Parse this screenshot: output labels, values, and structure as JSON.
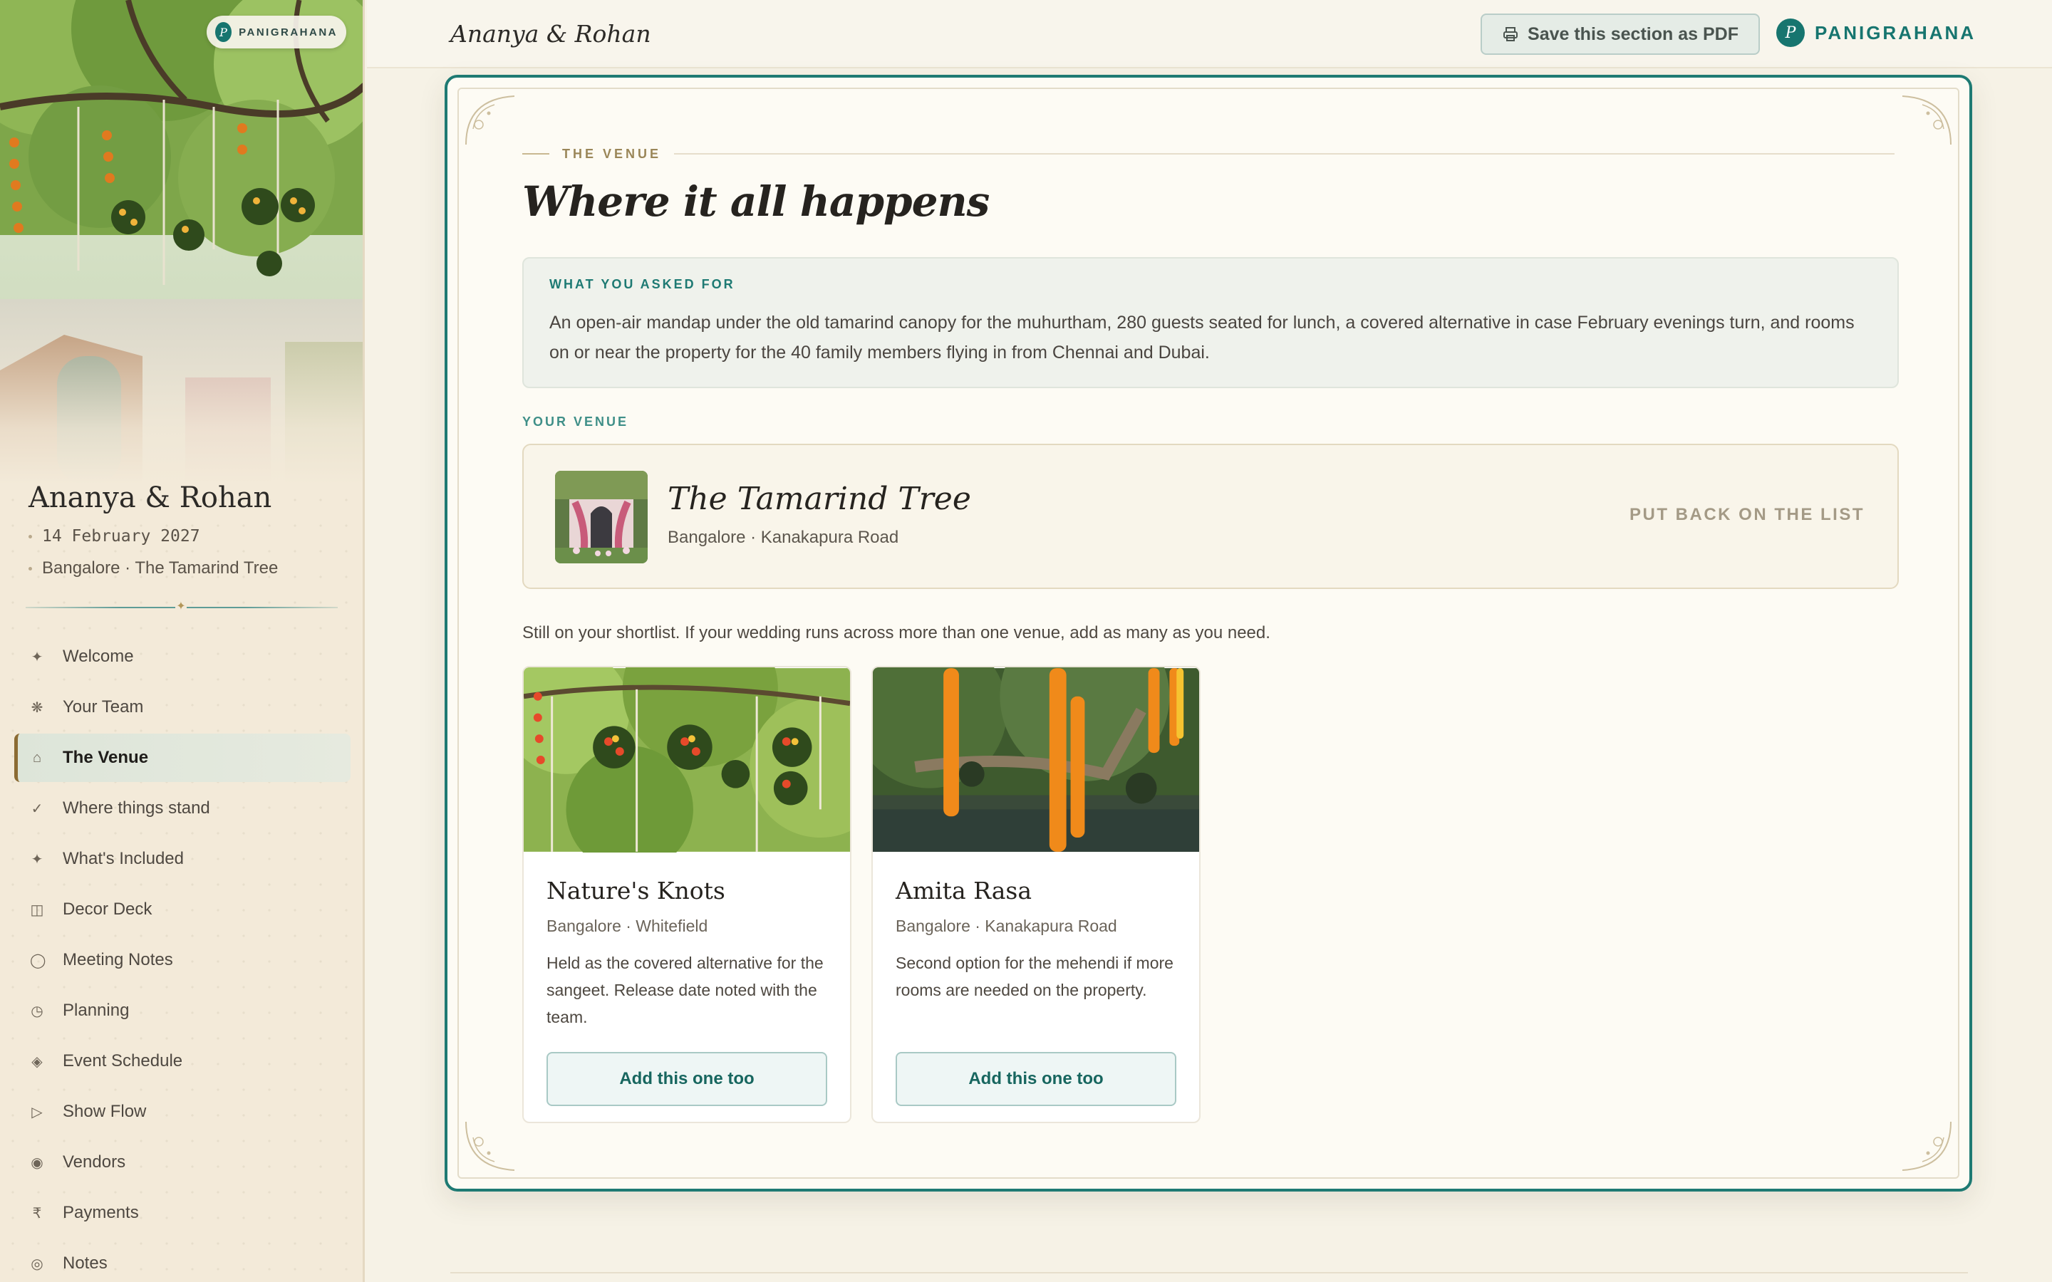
{
  "sidebar": {
    "brand_pill": "PANIGRAHANA",
    "brand_initial": "P",
    "couple_name": "Ananya & Rohan",
    "date": "14 February 2027",
    "location": "Bangalore · The Tamarind Tree",
    "divider_glyph": "✦",
    "items": [
      {
        "label": "Welcome",
        "icon": "✦",
        "icon_name": "sparkle-icon",
        "active": false
      },
      {
        "label": "Your Team",
        "icon": "❋",
        "icon_name": "flower-icon",
        "active": false
      },
      {
        "label": "The Venue",
        "icon": "⌂",
        "icon_name": "home-icon",
        "active": true
      },
      {
        "label": "Where things stand",
        "icon": "✓",
        "icon_name": "check-icon",
        "active": false
      },
      {
        "label": "What's Included",
        "icon": "✦",
        "icon_name": "sparkle-icon",
        "active": false
      },
      {
        "label": "Decor Deck",
        "icon": "◫",
        "icon_name": "deck-icon",
        "active": false
      },
      {
        "label": "Meeting Notes",
        "icon": "◯",
        "icon_name": "circle-icon",
        "active": false
      },
      {
        "label": "Planning",
        "icon": "◷",
        "icon_name": "clock-icon",
        "active": false
      },
      {
        "label": "Event Schedule",
        "icon": "◈",
        "icon_name": "diamond-icon",
        "active": false
      },
      {
        "label": "Show Flow",
        "icon": "▷",
        "icon_name": "play-icon",
        "active": false
      },
      {
        "label": "Vendors",
        "icon": "◉",
        "icon_name": "dot-circle-icon",
        "active": false
      },
      {
        "label": "Payments",
        "icon": "₹",
        "icon_name": "rupee-icon",
        "active": false
      },
      {
        "label": "Notes",
        "icon": "◎",
        "icon_name": "target-icon",
        "active": false
      }
    ]
  },
  "topbar": {
    "title": "Ananya & Rohan",
    "pdf_button": "Save this section as PDF",
    "brand": "PANIGRAHANA",
    "brand_initial": "P"
  },
  "venue_section": {
    "eyebrow": "THE VENUE",
    "title": "Where it all happens",
    "asked_label": "WHAT YOU ASKED FOR",
    "asked_text": "An open-air mandap under the old tamarind canopy for the muhurtham, 280 guests seated for lunch, a covered alternative in case February evenings turn, and rooms on or near the property for the 40 family members flying in from Chennai and Dubai.",
    "your_venue_label": "YOUR VENUE",
    "venue": {
      "name": "The Tamarind Tree",
      "location": "Bangalore · Kanakapura Road",
      "action": "PUT BACK ON THE LIST"
    },
    "shortlist_note": "Still on your shortlist. If your wedding runs across more than one venue, add as many as you need.",
    "shortlist": [
      {
        "name": "Nature's Knots",
        "location": "Bangalore · Whitefield",
        "description": "Held as the covered alternative for the sangeet. Release date noted with the team.",
        "button": "Add this one too"
      },
      {
        "name": "Amita Rasa",
        "location": "Bangalore · Kanakapura Road",
        "description": "Second option for the mehendi if more rooms are needed on the property.",
        "button": "Add this one too"
      }
    ]
  },
  "colors": {
    "accent_teal": "#1e7a73",
    "gold": "#9a8658",
    "sidebar_bg": "#f3ead9",
    "page_bg": "#f6f2e6"
  }
}
